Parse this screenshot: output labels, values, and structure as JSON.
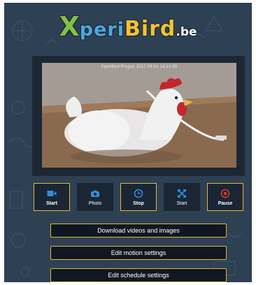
{
  "logo": {
    "letter_x": "X",
    "letters_peri": "peri",
    "letters_bird": "Bird",
    "suffix": ".be",
    "colors": {
      "x": "#7fc241",
      "peri": "#4fa8e0",
      "bird": "#f2c230",
      "suffix": "#ffffff"
    }
  },
  "video": {
    "overlay_text": "XperiBird Project 2017.09.01 14:21:05",
    "subject": "white toy chicken on a wooden shelf with a white cable"
  },
  "controls": [
    {
      "label": "Start",
      "icon": "video-camera-icon",
      "color": "#2f8fd8",
      "active": true
    },
    {
      "label": "Photo",
      "icon": "camera-icon",
      "color": "#2f8fd8",
      "active": false
    },
    {
      "label": "Stop",
      "icon": "clock-icon",
      "color": "#2f8fd8",
      "active": true
    },
    {
      "label": "Start",
      "icon": "move-arrows-icon",
      "color": "#2f8fd8",
      "active": false
    },
    {
      "label": "Pause",
      "icon": "stop-circle-icon",
      "color": "#d83a2e",
      "active": true
    }
  ],
  "actions": {
    "download": "Download videos and images",
    "motion": "Edit motion settings",
    "schedule": "Edit schedule settings"
  },
  "colors": {
    "background": "#2e4054",
    "button_border": "#e0b93a",
    "button_bg": "#0f1822"
  }
}
